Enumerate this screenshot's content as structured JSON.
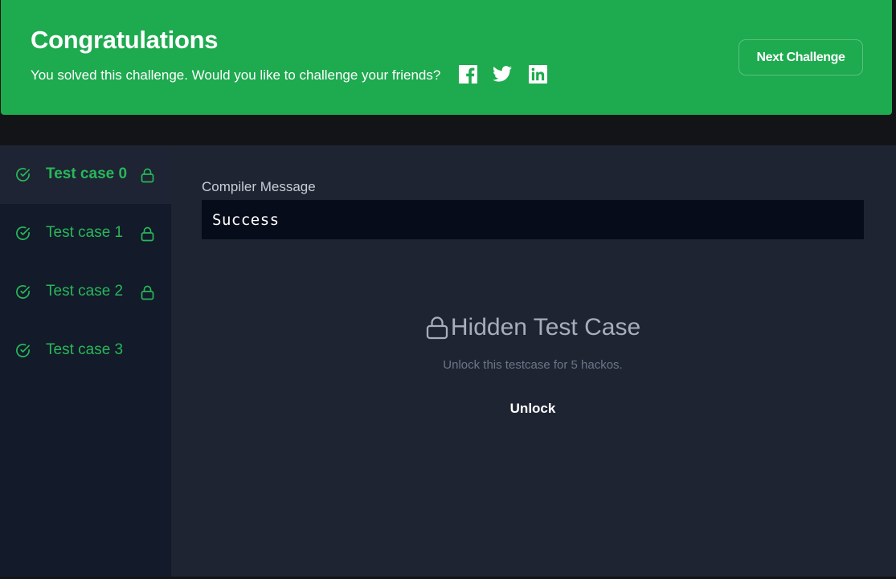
{
  "banner": {
    "title": "Congratulations",
    "subtitle": "You solved this challenge. Would you like to challenge your friends?",
    "share_icons": [
      "facebook-icon",
      "twitter-icon",
      "linkedin-icon"
    ],
    "next_label": "Next Challenge",
    "color": "#1eaa4f"
  },
  "sidebar": {
    "items": [
      {
        "label": "Test case 0",
        "status": "passed",
        "locked": true,
        "active": true
      },
      {
        "label": "Test case 1",
        "status": "passed",
        "locked": true,
        "active": false
      },
      {
        "label": "Test case 2",
        "status": "passed",
        "locked": true,
        "active": false
      },
      {
        "label": "Test case 3",
        "status": "passed",
        "locked": false,
        "active": false
      }
    ],
    "accent_color": "#27b85a"
  },
  "main": {
    "compiler_label": "Compiler Message",
    "compiler_output": "Success",
    "hidden_title": "Hidden Test Case",
    "hidden_subtitle": "Unlock this testcase for 5 hackos.",
    "unlock_label": "Unlock"
  }
}
